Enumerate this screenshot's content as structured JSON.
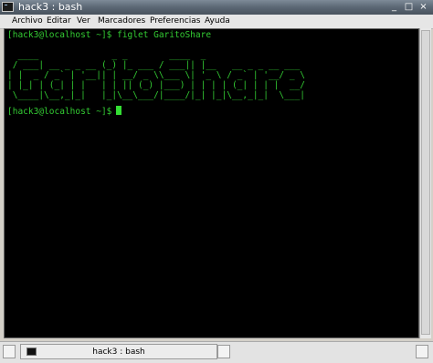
{
  "window": {
    "title": "hack3 : bash"
  },
  "menu": [
    "Archivo",
    "Editar",
    "Ver",
    "Marcadores",
    "Preferencias",
    "Ayuda"
  ],
  "terminal": {
    "line1": "[hack3@localhost ~]$ figlet GaritoShare",
    "banner": [
      "  ____              _ _        ____  _                    ",
      " / ___| __ _ _ __ (_) |_ ___ / ___|| |__   __ _ _ __ ___ ",
      "| |  _ / _` | '__|| | __/ _ \\\\___ \\| '_ \\ / _` | '__/ _ \\",
      "| |_| | (_| | |   | | || (_) |___) | | | | (_| | | |  __/",
      " \\____|\\__,_|_|   |_|\\__\\___/|____/|_| |_|\\__,_|_|  \\___|"
    ],
    "prompt": "[hack3@localhost ~]$",
    "text_color": "#33cc33"
  },
  "taskbar": {
    "task_label": "hack3 : bash"
  }
}
